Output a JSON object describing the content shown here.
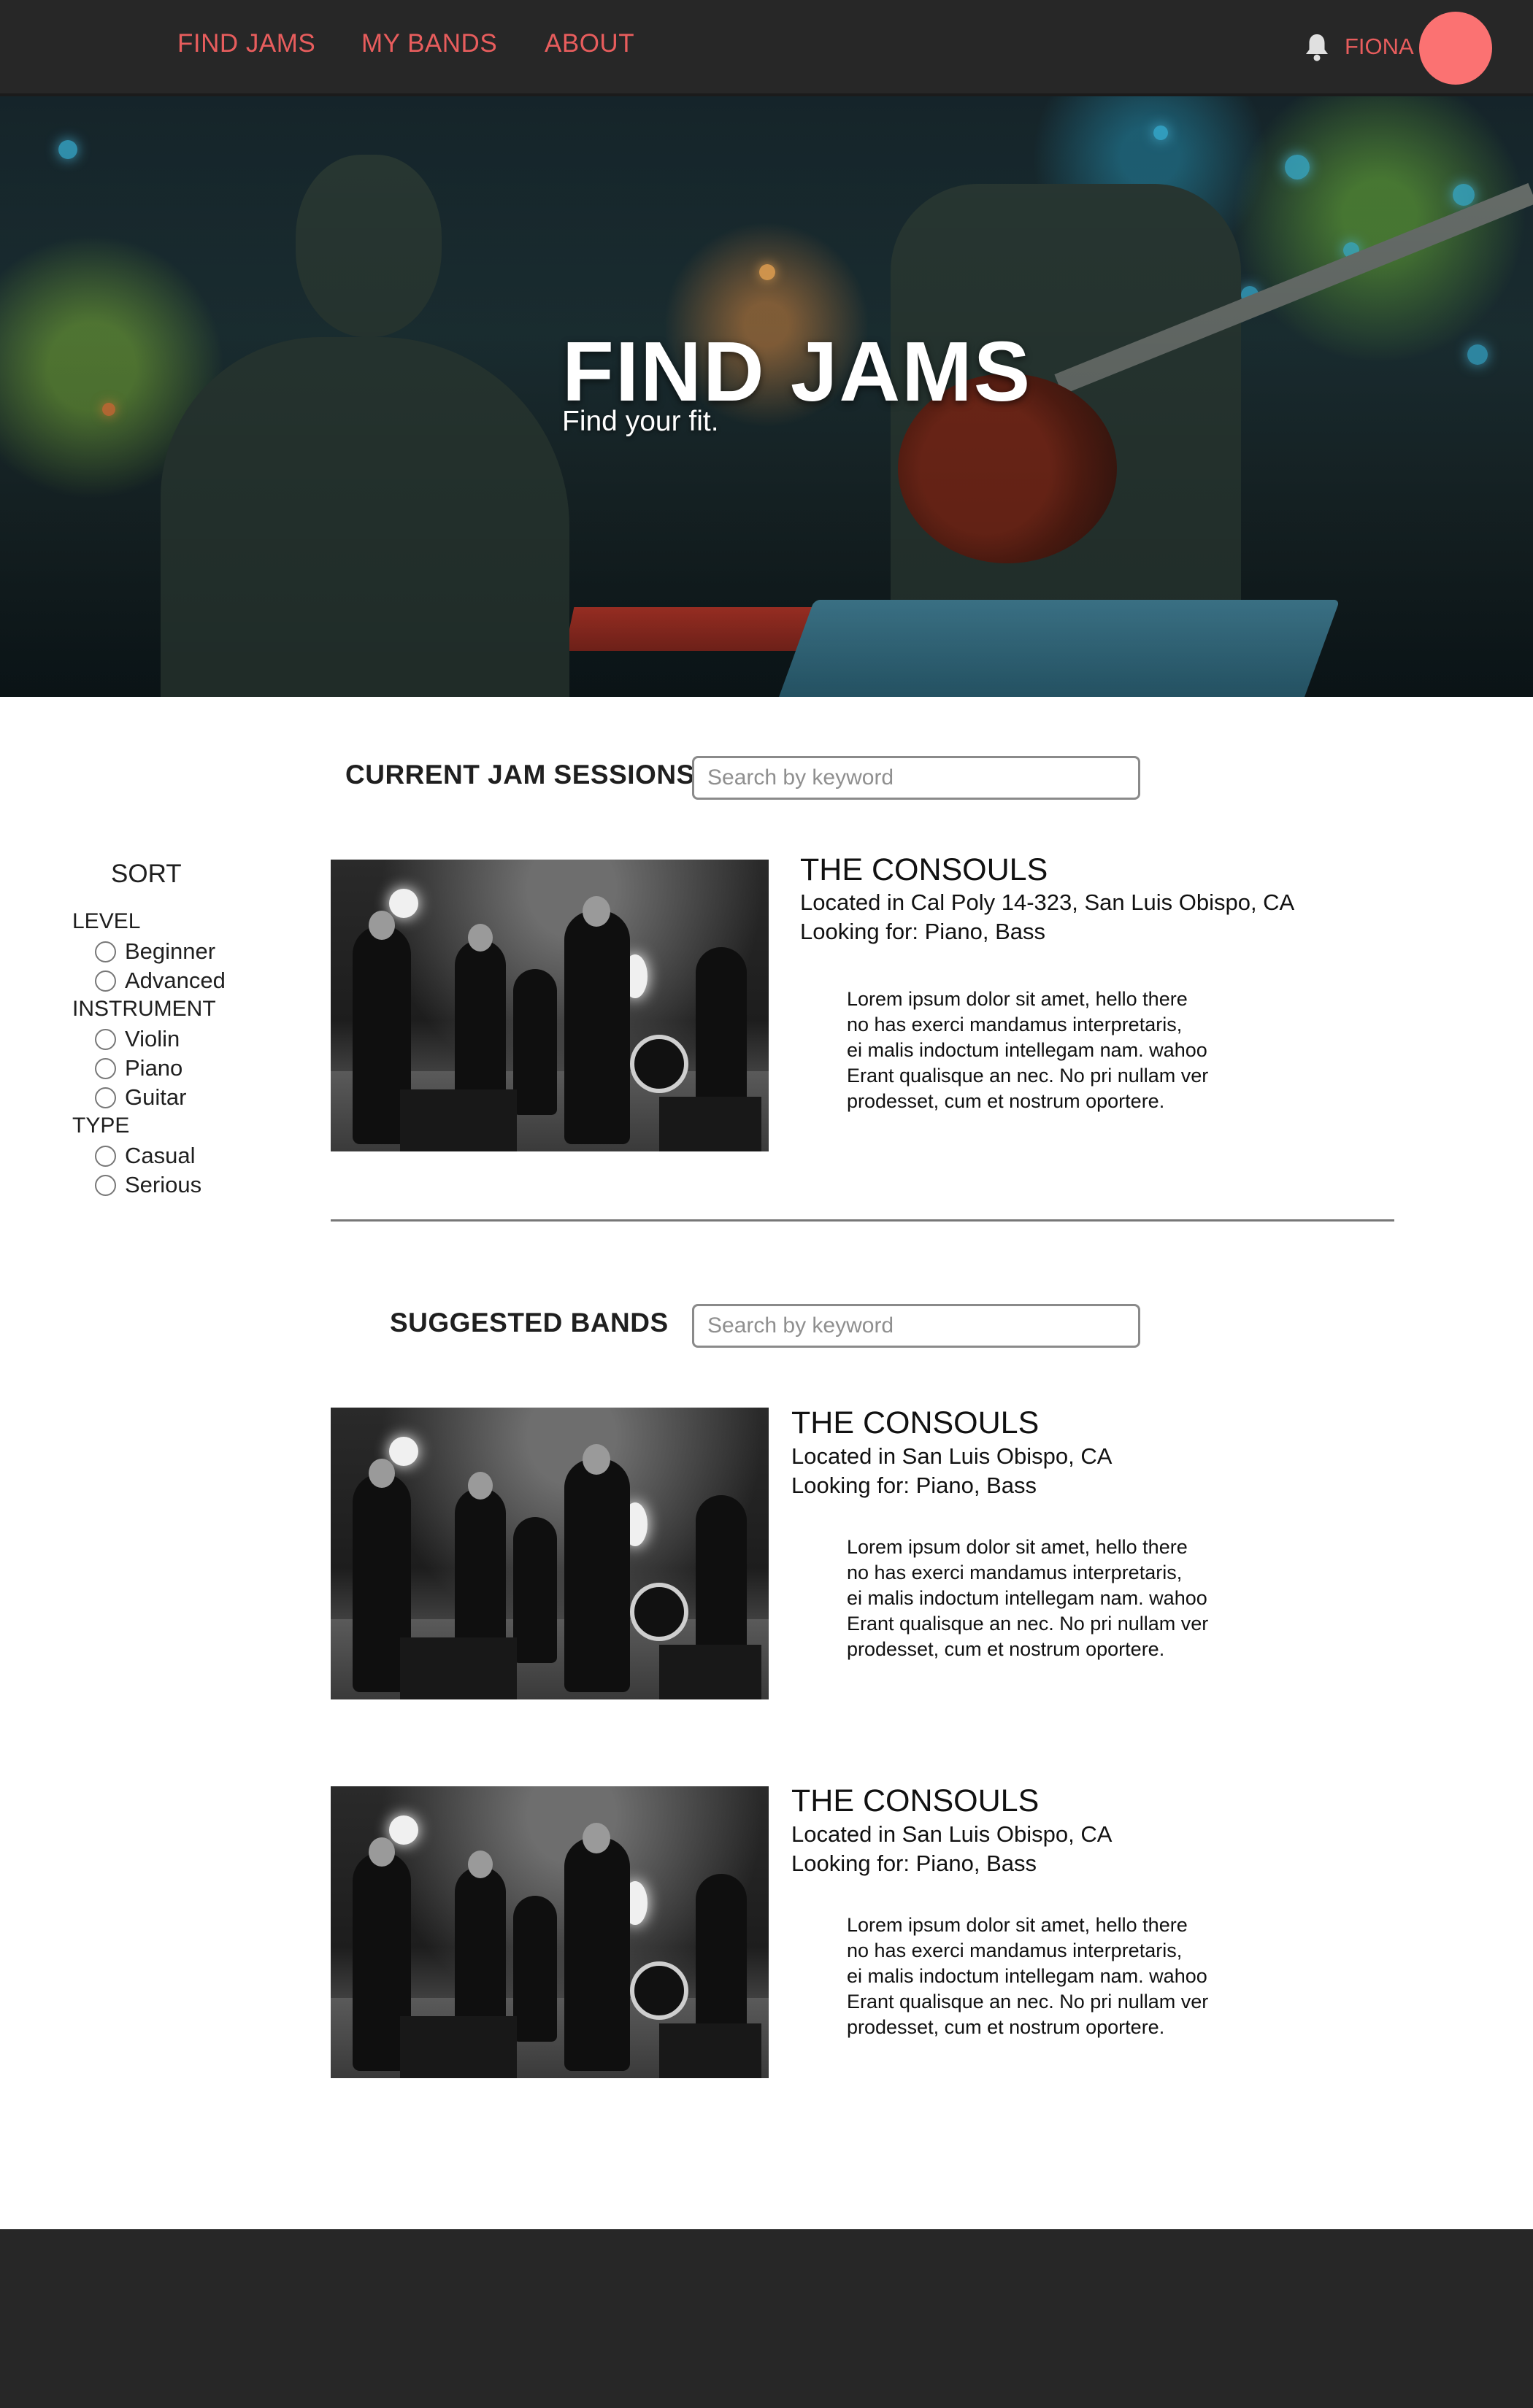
{
  "nav": {
    "links": [
      "FIND JAMS",
      "MY BANDS",
      "ABOUT"
    ],
    "user_name": "FIONA",
    "bell_icon": "bell-icon",
    "accent_color": "#e85d5d",
    "avatar_color": "#fb7272"
  },
  "hero": {
    "title": "FIND JAMS",
    "subtitle": "Find your fit."
  },
  "sidebar": {
    "title": "SORT",
    "groups": [
      {
        "label": "LEVEL",
        "options": [
          "Beginner",
          "Advanced"
        ]
      },
      {
        "label": "INSTRUMENT",
        "options": [
          "Violin",
          "Piano",
          "Guitar"
        ]
      },
      {
        "label": "TYPE",
        "options": [
          "Casual",
          "Serious"
        ]
      }
    ]
  },
  "sessions": {
    "title": "CURRENT JAM SESSIONS",
    "search_placeholder": "Search by keyword",
    "items": [
      {
        "name": "THE CONSOULS",
        "location": "Located in Cal Poly 14-323, San Luis Obispo, CA",
        "looking_for": "Looking for: Piano, Bass",
        "description": "Lorem ipsum dolor sit amet, hello there\nno has exerci mandamus interpretaris,\nei malis indoctum intellegam nam. wahoo\nErant qualisque an nec. No pri nullam ver\nprodesset, cum et nostrum oportere."
      }
    ]
  },
  "suggested": {
    "title": "SUGGESTED BANDS",
    "search_placeholder": "Search by keyword",
    "items": [
      {
        "name": "THE CONSOULS",
        "location": "Located in San Luis Obispo, CA",
        "looking_for": "Looking for: Piano, Bass",
        "description": "Lorem ipsum dolor sit amet, hello there\nno has exerci mandamus interpretaris,\nei malis indoctum intellegam nam. wahoo\nErant qualisque an nec. No pri nullam ver\nprodesset, cum et nostrum oportere."
      },
      {
        "name": "THE CONSOULS",
        "location": "Located in San Luis Obispo, CA",
        "looking_for": "Looking for: Piano, Bass",
        "description": "Lorem ipsum dolor sit amet, hello there\nno has exerci mandamus interpretaris,\nei malis indoctum intellegam nam. wahoo\nErant qualisque an nec. No pri nullam ver\nprodesset, cum et nostrum oportere."
      }
    ]
  }
}
